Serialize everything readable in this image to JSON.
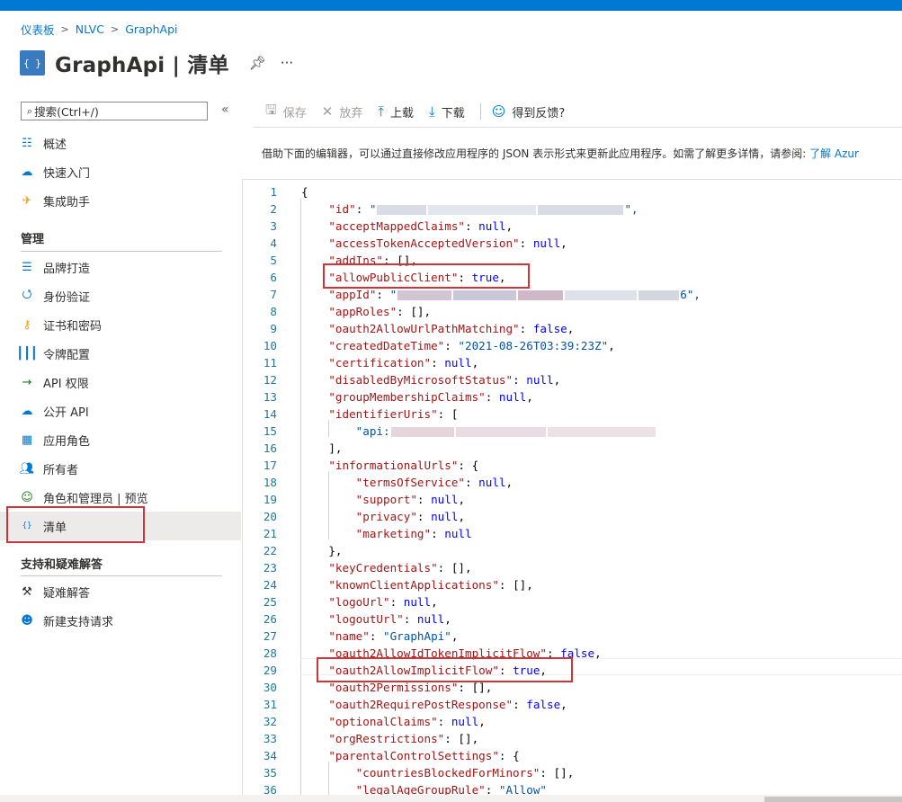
{
  "breadcrumb": [
    "仪表板",
    "NLVC",
    "GraphApi"
  ],
  "page": {
    "title": "GraphApi | 清单",
    "icon": "{ }"
  },
  "search": {
    "placeholder": "搜索(Ctrl+/)"
  },
  "nav": {
    "top": [
      {
        "label": "概述",
        "icon": "overview-icon"
      },
      {
        "label": "快速入门",
        "icon": "quickstart-cloud-icon"
      },
      {
        "label": "集成助手",
        "icon": "rocket-icon"
      }
    ],
    "manage_header": "管理",
    "manage": [
      {
        "label": "品牌打造",
        "icon": "branding-icon"
      },
      {
        "label": "身份验证",
        "icon": "authentication-icon"
      },
      {
        "label": "证书和密码",
        "icon": "key-icon"
      },
      {
        "label": "令牌配置",
        "icon": "token-bars-icon"
      },
      {
        "label": "API 权限",
        "icon": "api-permissions-icon"
      },
      {
        "label": "公开 API",
        "icon": "cloud-api-icon"
      },
      {
        "label": "应用角色",
        "icon": "app-roles-grid-icon"
      },
      {
        "label": "所有者",
        "icon": "owners-icon"
      },
      {
        "label": "角色和管理员 | 预览",
        "icon": "roles-admins-icon"
      },
      {
        "label": "清单",
        "icon": "manifest-icon",
        "active": true
      }
    ],
    "support_header": "支持和疑难解答",
    "support": [
      {
        "label": "疑难解答",
        "icon": "wrench-icon"
      },
      {
        "label": "新建支持请求",
        "icon": "support-person-icon"
      }
    ]
  },
  "toolbar": {
    "save": "保存",
    "discard": "放弃",
    "upload": "上载",
    "download": "下载",
    "feedback": "得到反馈?"
  },
  "description": {
    "text": "借助下面的编辑器，可以通过直接修改应用程序的 JSON 表示形式来更新此应用程序。如需了解更多详情，请参阅: ",
    "link": "了解 Azur"
  },
  "editor_lines": [
    "{",
    "    \"id\": \"",
    "    \"acceptMappedClaims\": null,",
    "    \"accessTokenAcceptedVersion\": null,",
    "    \"addIns\": [],",
    "    \"allowPublicClient\": true,",
    "    \"appId\": \"",
    "    \"appRoles\": [],",
    "    \"oauth2AllowUrlPathMatching\": false,",
    "    \"createdDateTime\": \"2021-08-26T03:39:23Z\",",
    "    \"certification\": null,",
    "    \"disabledByMicrosoftStatus\": null,",
    "    \"groupMembershipClaims\": null,",
    "    \"identifierUris\": [",
    "        \"api:",
    "    ],",
    "    \"informationalUrls\": {",
    "        \"termsOfService\": null,",
    "        \"support\": null,",
    "        \"privacy\": null,",
    "        \"marketing\": null",
    "    },",
    "    \"keyCredentials\": [],",
    "    \"knownClientApplications\": [],",
    "    \"logoUrl\": null,",
    "    \"logoutUrl\": null,",
    "    \"name\": \"GraphApi\",",
    "    \"oauth2AllowIdTokenImplicitFlow\": false,",
    "    \"oauth2AllowImplicitFlow\": true,",
    "    \"oauth2Permissions\": [],",
    "    \"oauth2RequirePostResponse\": false,",
    "    \"optionalClaims\": null,",
    "    \"orgRestrictions\": [],",
    "    \"parentalControlSettings\": {",
    "        \"countriesBlockedForMinors\": [],",
    "        \"legalAgeGroupRule\": \"Allow\""
  ]
}
